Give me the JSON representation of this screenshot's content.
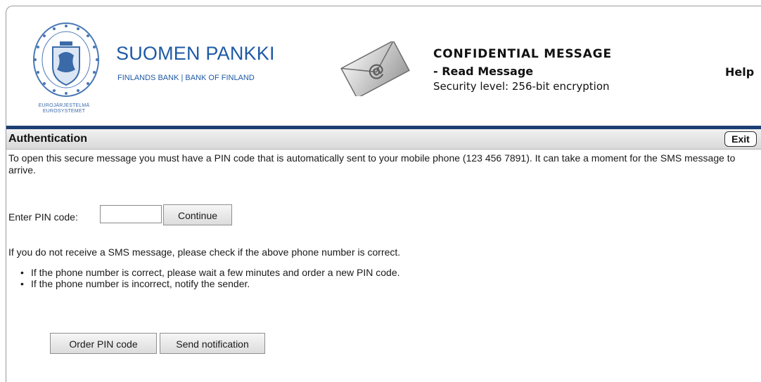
{
  "header": {
    "seal_caption_line1": "EUROJÄRJESTELMÄ",
    "seal_caption_line2": "EUROSYSTEMET",
    "brand_name": "SUOMEN PANKKI",
    "brand_sub": "FINLANDS BANK | BANK OF FINLAND",
    "confidential_title": "CONFIDENTIAL MESSAGE",
    "confidential_subtitle": "- Read Message",
    "security_level": "Security level: 256-bit encryption",
    "help_label": "Help"
  },
  "authbar": {
    "title": "Authentication",
    "exit_label": "Exit"
  },
  "content": {
    "intro_text": "To open this secure message you must have a PIN code that is automatically sent to your mobile phone (123 456 7891). It can take a moment for the SMS message to arrive.",
    "pin_label": "Enter PIN code:",
    "pin_value": "",
    "continue_label": "Continue",
    "notice_text": "If you do not receive a SMS message, please check if the above phone number is correct.",
    "bullets": [
      "If the phone number is correct, please wait a few minutes and order a new PIN code.",
      "If the phone number is incorrect, notify the sender."
    ],
    "order_pin_label": "Order PIN code",
    "send_notification_label": "Send notification"
  },
  "colors": {
    "brand_blue": "#1f5aa6",
    "header_rule": "#1b3f73"
  },
  "icons": {
    "seal": "bank-seal-icon",
    "envelope": "email-envelope-icon"
  }
}
